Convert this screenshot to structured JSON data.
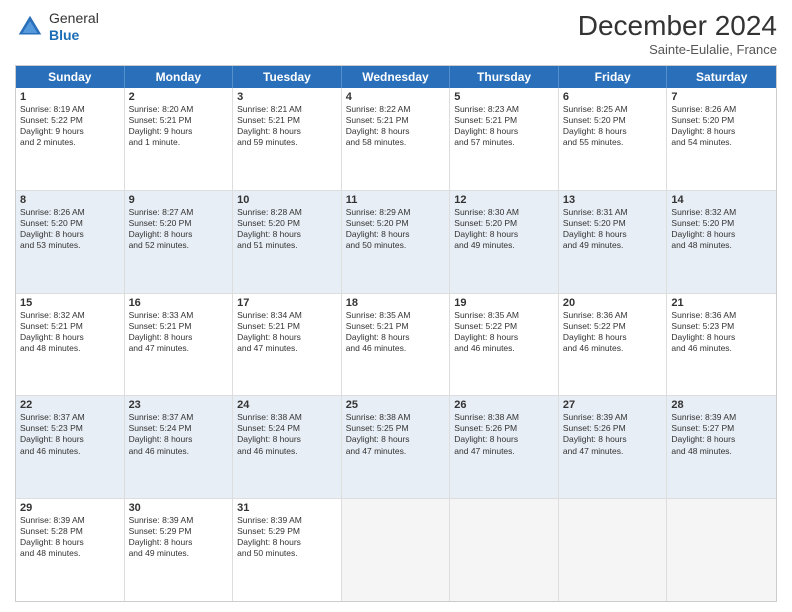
{
  "header": {
    "logo_line1": "General",
    "logo_line2": "Blue",
    "title": "December 2024",
    "subtitle": "Sainte-Eulalie, France"
  },
  "days": [
    "Sunday",
    "Monday",
    "Tuesday",
    "Wednesday",
    "Thursday",
    "Friday",
    "Saturday"
  ],
  "weeks": [
    [
      {
        "day": "1",
        "text": "Sunrise: 8:19 AM\nSunset: 5:22 PM\nDaylight: 9 hours\nand 2 minutes."
      },
      {
        "day": "2",
        "text": "Sunrise: 8:20 AM\nSunset: 5:21 PM\nDaylight: 9 hours\nand 1 minute."
      },
      {
        "day": "3",
        "text": "Sunrise: 8:21 AM\nSunset: 5:21 PM\nDaylight: 8 hours\nand 59 minutes."
      },
      {
        "day": "4",
        "text": "Sunrise: 8:22 AM\nSunset: 5:21 PM\nDaylight: 8 hours\nand 58 minutes."
      },
      {
        "day": "5",
        "text": "Sunrise: 8:23 AM\nSunset: 5:21 PM\nDaylight: 8 hours\nand 57 minutes."
      },
      {
        "day": "6",
        "text": "Sunrise: 8:25 AM\nSunset: 5:20 PM\nDaylight: 8 hours\nand 55 minutes."
      },
      {
        "day": "7",
        "text": "Sunrise: 8:26 AM\nSunset: 5:20 PM\nDaylight: 8 hours\nand 54 minutes."
      }
    ],
    [
      {
        "day": "8",
        "text": "Sunrise: 8:26 AM\nSunset: 5:20 PM\nDaylight: 8 hours\nand 53 minutes."
      },
      {
        "day": "9",
        "text": "Sunrise: 8:27 AM\nSunset: 5:20 PM\nDaylight: 8 hours\nand 52 minutes."
      },
      {
        "day": "10",
        "text": "Sunrise: 8:28 AM\nSunset: 5:20 PM\nDaylight: 8 hours\nand 51 minutes."
      },
      {
        "day": "11",
        "text": "Sunrise: 8:29 AM\nSunset: 5:20 PM\nDaylight: 8 hours\nand 50 minutes."
      },
      {
        "day": "12",
        "text": "Sunrise: 8:30 AM\nSunset: 5:20 PM\nDaylight: 8 hours\nand 49 minutes."
      },
      {
        "day": "13",
        "text": "Sunrise: 8:31 AM\nSunset: 5:20 PM\nDaylight: 8 hours\nand 49 minutes."
      },
      {
        "day": "14",
        "text": "Sunrise: 8:32 AM\nSunset: 5:20 PM\nDaylight: 8 hours\nand 48 minutes."
      }
    ],
    [
      {
        "day": "15",
        "text": "Sunrise: 8:32 AM\nSunset: 5:21 PM\nDaylight: 8 hours\nand 48 minutes."
      },
      {
        "day": "16",
        "text": "Sunrise: 8:33 AM\nSunset: 5:21 PM\nDaylight: 8 hours\nand 47 minutes."
      },
      {
        "day": "17",
        "text": "Sunrise: 8:34 AM\nSunset: 5:21 PM\nDaylight: 8 hours\nand 47 minutes."
      },
      {
        "day": "18",
        "text": "Sunrise: 8:35 AM\nSunset: 5:21 PM\nDaylight: 8 hours\nand 46 minutes."
      },
      {
        "day": "19",
        "text": "Sunrise: 8:35 AM\nSunset: 5:22 PM\nDaylight: 8 hours\nand 46 minutes."
      },
      {
        "day": "20",
        "text": "Sunrise: 8:36 AM\nSunset: 5:22 PM\nDaylight: 8 hours\nand 46 minutes."
      },
      {
        "day": "21",
        "text": "Sunrise: 8:36 AM\nSunset: 5:23 PM\nDaylight: 8 hours\nand 46 minutes."
      }
    ],
    [
      {
        "day": "22",
        "text": "Sunrise: 8:37 AM\nSunset: 5:23 PM\nDaylight: 8 hours\nand 46 minutes."
      },
      {
        "day": "23",
        "text": "Sunrise: 8:37 AM\nSunset: 5:24 PM\nDaylight: 8 hours\nand 46 minutes."
      },
      {
        "day": "24",
        "text": "Sunrise: 8:38 AM\nSunset: 5:24 PM\nDaylight: 8 hours\nand 46 minutes."
      },
      {
        "day": "25",
        "text": "Sunrise: 8:38 AM\nSunset: 5:25 PM\nDaylight: 8 hours\nand 47 minutes."
      },
      {
        "day": "26",
        "text": "Sunrise: 8:38 AM\nSunset: 5:26 PM\nDaylight: 8 hours\nand 47 minutes."
      },
      {
        "day": "27",
        "text": "Sunrise: 8:39 AM\nSunset: 5:26 PM\nDaylight: 8 hours\nand 47 minutes."
      },
      {
        "day": "28",
        "text": "Sunrise: 8:39 AM\nSunset: 5:27 PM\nDaylight: 8 hours\nand 48 minutes."
      }
    ],
    [
      {
        "day": "29",
        "text": "Sunrise: 8:39 AM\nSunset: 5:28 PM\nDaylight: 8 hours\nand 48 minutes."
      },
      {
        "day": "30",
        "text": "Sunrise: 8:39 AM\nSunset: 5:29 PM\nDaylight: 8 hours\nand 49 minutes."
      },
      {
        "day": "31",
        "text": "Sunrise: 8:39 AM\nSunset: 5:29 PM\nDaylight: 8 hours\nand 50 minutes."
      },
      {
        "day": "",
        "text": ""
      },
      {
        "day": "",
        "text": ""
      },
      {
        "day": "",
        "text": ""
      },
      {
        "day": "",
        "text": ""
      }
    ]
  ]
}
